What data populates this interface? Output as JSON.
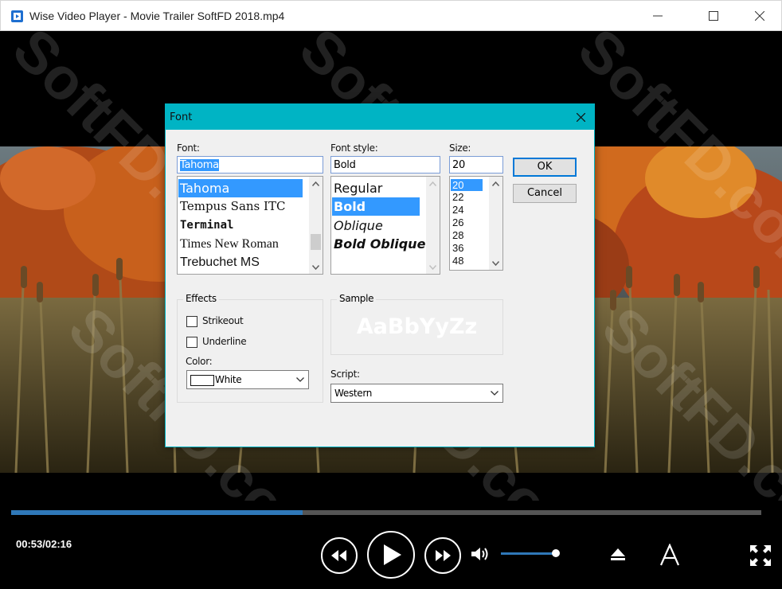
{
  "window": {
    "title": "Wise Video Player - Movie Trailer SoftFD 2018.mp4",
    "controls": [
      "minimize-icon",
      "maximize-icon",
      "close-icon"
    ]
  },
  "watermark": "SoftFD.com",
  "dialog": {
    "title": "Font",
    "font_label": "Font:",
    "font_value": "Tahoma",
    "font_list": [
      "Tahoma",
      "Tempus Sans ITC",
      "Terminal",
      "Times New Roman",
      "Trebuchet MS"
    ],
    "style_label": "Font style:",
    "style_value": "Bold",
    "style_list": [
      "Regular",
      "Bold",
      "Oblique",
      "Bold Oblique"
    ],
    "size_label": "Size:",
    "size_value": "20",
    "size_list": [
      "20",
      "22",
      "24",
      "26",
      "28",
      "36",
      "48"
    ],
    "ok": "OK",
    "cancel": "Cancel",
    "effects_label": "Effects",
    "strikeout": "Strikeout",
    "underline": "Underline",
    "color_label": "Color:",
    "color_value": "White",
    "sample_label": "Sample",
    "sample_text": "AaBbYyZz",
    "script_label": "Script:",
    "script_value": "Western"
  },
  "player": {
    "time": "00:53/02:16",
    "progress_fraction": 0.389,
    "volume_fraction": 0.96,
    "accent": "#2f78b8"
  }
}
